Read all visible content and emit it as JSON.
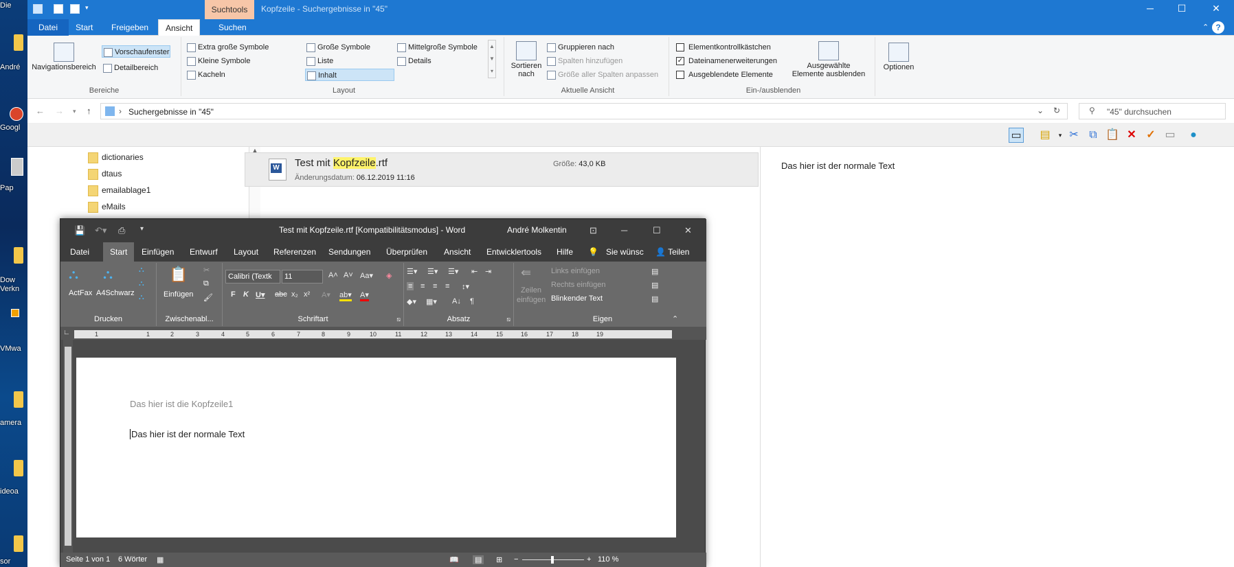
{
  "desktop": {
    "labels": [
      "Die",
      "André",
      "Googl",
      "Pap",
      "Dow\nVerkn",
      "VMwa",
      "amera",
      "ideoa",
      "sor"
    ]
  },
  "explorer": {
    "title": "Kopfzeile - Suchergebnisse in \"45\"",
    "context_tab": "Suchtools",
    "tabs": [
      "Datei",
      "Start",
      "Freigeben",
      "Ansicht",
      "Suchen"
    ],
    "ribbon": {
      "bereiche": {
        "group": "Bereiche",
        "navigationsbereich": "Navigationsbereich",
        "vorschaufenster": "Vorschaufenster",
        "detailbereich": "Detailbereich"
      },
      "layout": {
        "group": "Layout",
        "items": [
          "Extra große Symbole",
          "Große Symbole",
          "Mittelgroße Symbole",
          "Kleine Symbole",
          "Liste",
          "Details",
          "Kacheln",
          "Inhalt"
        ]
      },
      "aktuelle_ansicht": {
        "group": "Aktuelle Ansicht",
        "sortieren": "Sortieren",
        "nach": "nach",
        "gruppieren": "Gruppieren nach",
        "spalten": "Spalten hinzufügen",
        "groesse": "Größe aller Spalten anpassen"
      },
      "ein_ausblenden": {
        "group": "Ein-/ausblenden",
        "elementkontroll": "Elementkontrollkästchen",
        "dateinamen": "Dateinamenerweiterungen",
        "ausgeblendete": "Ausgeblendete Elemente",
        "ausgewaehlte1": "Ausgewählte",
        "ausgewaehlte2": "Elemente ausblenden"
      },
      "optionen": "Optionen"
    },
    "address": "Suchergebnisse in \"45\"",
    "search_placeholder": "\"45\" durchsuchen",
    "folders": [
      "dictionaries",
      "dtaus",
      "emailablage1",
      "eMails"
    ],
    "result": {
      "name_pre": "Test mit ",
      "name_hl": "Kopfzeile",
      "name_post": ".rtf",
      "date_label": "Änderungsdatum:",
      "date_value": "06.12.2019 11:16",
      "size_label": "Größe:",
      "size_value": "43,0 KB"
    },
    "preview_text": "Das hier ist der normale Text"
  },
  "word": {
    "title": "Test mit Kopfzeile.rtf [Kompatibilitätsmodus]  -  Word",
    "user": "André Molkentin",
    "tabs": [
      "Datei",
      "Start",
      "Einfügen",
      "Entwurf",
      "Layout",
      "Referenzen",
      "Sendungen",
      "Überprüfen",
      "Ansicht",
      "Entwicklertools",
      "Hilfe",
      "Sie wünsc",
      "Teilen"
    ],
    "ribbon": {
      "drucken": {
        "group": "Drucken",
        "actfax": "ActFax",
        "a4": "A4Schwarz"
      },
      "zwischenablage": {
        "group": "Zwischenabl...",
        "einfuegen": "Einfügen"
      },
      "schriftart": {
        "group": "Schriftart",
        "font": "Calibri (Textk",
        "size": "11"
      },
      "absatz": {
        "group": "Absatz"
      },
      "eigen": {
        "group": "Eigen",
        "zeilen1": "Zeilen",
        "zeilen2": "einfügen",
        "links": "Links einfügen",
        "rechts": "Rechts einfügen",
        "blink": "Blinkender Text"
      }
    },
    "ruler": [
      "1",
      "1",
      "2",
      "3",
      "4",
      "5",
      "6",
      "7",
      "8",
      "9",
      "10",
      "11",
      "12",
      "13",
      "14",
      "15",
      "16",
      "17",
      "18",
      "19"
    ],
    "document": {
      "header": "Das hier ist die Kopfzeile1",
      "body": "Das hier ist der normale Text"
    },
    "status": {
      "page": "Seite 1 von 1",
      "words": "6 Wörter",
      "zoom": "110 %"
    }
  }
}
